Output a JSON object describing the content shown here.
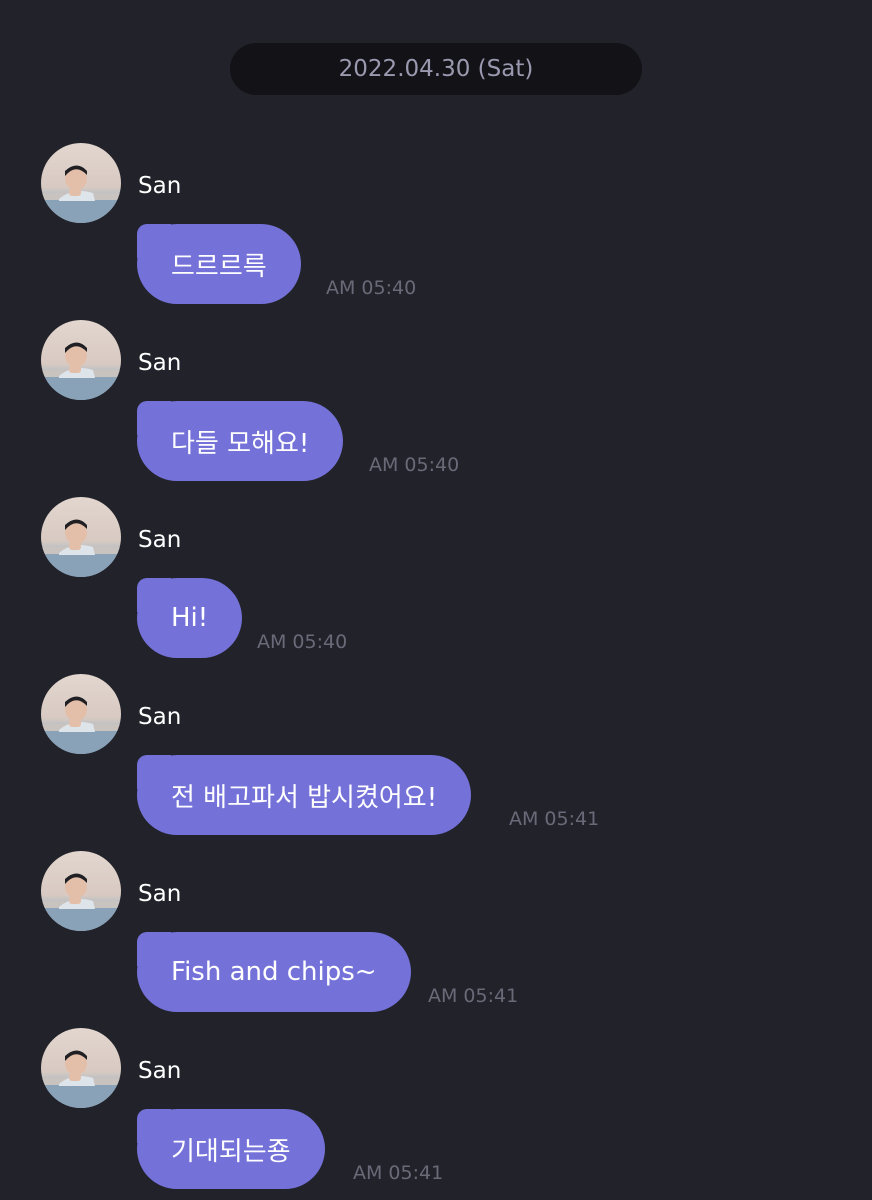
{
  "date_divider": "2022.04.30 (Sat)",
  "messages": [
    {
      "sender": "San",
      "text": "드르르륵",
      "time": "AM 05:40",
      "avatar": "profile-photo"
    },
    {
      "sender": "San",
      "text": "다들 모해요!",
      "time": "AM 05:40",
      "avatar": "profile-photo"
    },
    {
      "sender": "San",
      "text": "Hi!",
      "time": "AM 05:40",
      "avatar": "profile-photo"
    },
    {
      "sender": "San",
      "text": "전 배고파서 밥시켰어요!",
      "time": "AM 05:41",
      "avatar": "profile-photo"
    },
    {
      "sender": "San",
      "text": "Fish and chips~",
      "time": "AM 05:41",
      "avatar": "profile-photo"
    },
    {
      "sender": "San",
      "text": "기대되는죵",
      "time": "AM 05:41",
      "avatar": "profile-photo"
    }
  ],
  "colors": {
    "background": "#22222a",
    "bubble": "#7472d8",
    "date_pill": "#121217",
    "timestamp": "#6a6978"
  }
}
